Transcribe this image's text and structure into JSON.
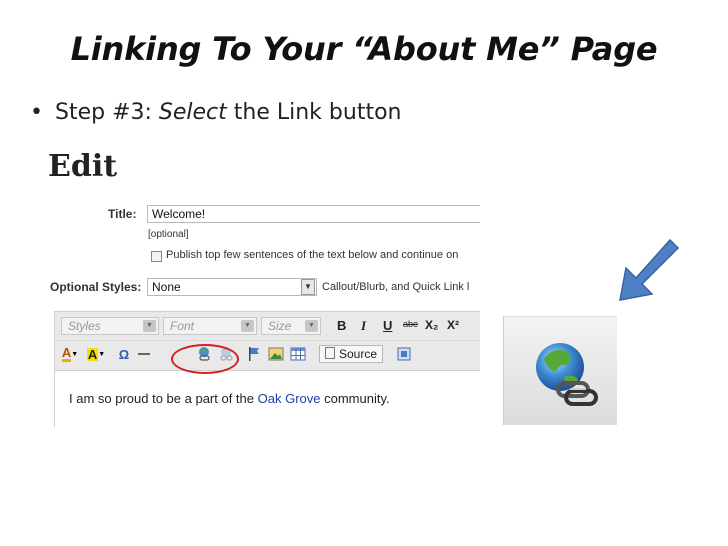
{
  "slide": {
    "title": "Linking To Your “About Me” Page",
    "bullet_prefix": "Step #3: ",
    "bullet_emphasis": "Select",
    "bullet_suffix": " the Link button"
  },
  "editor_screenshot": {
    "heading": "Edit",
    "title_label": "Title:",
    "title_value": "Welcome!",
    "optional_note": "[optional]",
    "publish_checkbox_label": "Publish top few sentences of the text below and continue on",
    "optional_styles_label": "Optional Styles:",
    "optional_styles_value": "None",
    "optional_styles_hint": "Callout/Blurb, and Quick Link l",
    "toolbar": {
      "styles_combo": "Styles",
      "font_combo": "Font",
      "size_combo": "Size",
      "bold": "B",
      "italic": "I",
      "underline": "U",
      "strike": "abe",
      "subscript": "X₂",
      "superscript": "X²",
      "source_button": "Source"
    },
    "body_text_before": "I am so proud to be a part of the ",
    "body_text_link": "Oak Grove",
    "body_text_after": " community."
  },
  "colors": {
    "highlight_circle": "#d42020",
    "arrow_fill": "#4f7fc4",
    "link_text": "#1a3fa8"
  },
  "icons": [
    "text-color-icon",
    "background-color-icon",
    "omega-icon",
    "horizontal-rule-icon",
    "link-icon",
    "unlink-icon",
    "anchor-flag-icon",
    "image-icon",
    "table-icon",
    "source-icon",
    "maximize-icon",
    "pointing-arrow-icon"
  ]
}
